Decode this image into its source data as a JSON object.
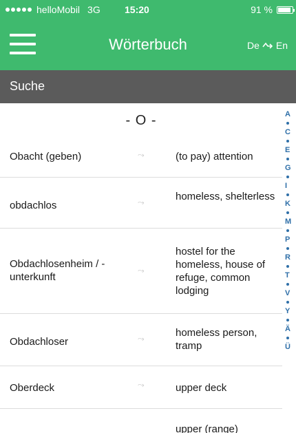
{
  "status_bar": {
    "carrier": "helloMobil",
    "network": "3G",
    "time": "15:20",
    "battery": "91 %",
    "battery_level": 0.91,
    "signal_dots": 5
  },
  "nav": {
    "menu_icon": "hamburger-icon",
    "title": "Wörterbuch",
    "lang_from": "De",
    "lang_to": "En",
    "swap_icon": "swap-arrow-icon"
  },
  "search": {
    "placeholder": "Suche"
  },
  "section": {
    "header": "- O -"
  },
  "entries": [
    {
      "de": "Obacht (geben)",
      "en": "(to pay) attention"
    },
    {
      "de": "obdachlos",
      "en": "homeless, shelterless"
    },
    {
      "de": "Obdachlosenheim / -unterkunft",
      "en": "hostel for the homeless, house of refuge, common lodging"
    },
    {
      "de": "Obdachloser",
      "en": "homeless person, tramp"
    },
    {
      "de": "Oberdeck",
      "en": "upper deck"
    },
    {
      "de": "",
      "en": "upper (range)"
    }
  ],
  "entry_arrow_icon": "translation-arrow-icon",
  "alphabet_index": [
    "A",
    "C",
    "E",
    "G",
    "I",
    "K",
    "M",
    "P",
    "R",
    "T",
    "V",
    "Y",
    "Ä",
    "Ü"
  ],
  "colors": {
    "brand_green": "#3fba6e",
    "search_bar": "#5b5b5b",
    "index_blue": "#2f6fa8",
    "arrow_gray": "#c4c4c4"
  }
}
